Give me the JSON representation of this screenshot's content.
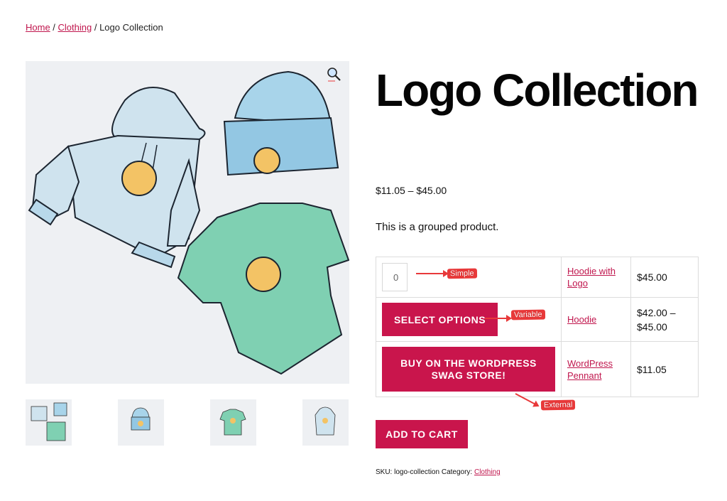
{
  "breadcrumb": {
    "home": "Home",
    "sep1": " / ",
    "category": "Clothing",
    "sep2": " / ",
    "current": "Logo Collection"
  },
  "product": {
    "title": "Logo Collection",
    "price_range": "$11.05 – $45.00",
    "description": "This is a grouped product."
  },
  "grouped_items": [
    {
      "control": "0",
      "name": "Hoodie with Logo",
      "price": "$45.00",
      "note": "Simple"
    },
    {
      "control": "SELECT OPTIONS",
      "name": "Hoodie",
      "price": "$42.00 – $45.00",
      "note": "Variable"
    },
    {
      "control": "BUY ON THE WORDPRESS SWAG STORE!",
      "name": "WordPress Pennant",
      "price": "$11.05",
      "note": "External"
    }
  ],
  "actions": {
    "add_to_cart": "ADD TO CART"
  },
  "meta": {
    "sku_label": "SKU:",
    "sku": "logo-collection",
    "category_label": "Category:",
    "category": "Clothing"
  },
  "icons": {
    "zoom": "magnifier-icon"
  },
  "colors": {
    "accent": "#c9154c",
    "link": "#c0164d",
    "annotation": "#e8393a"
  }
}
